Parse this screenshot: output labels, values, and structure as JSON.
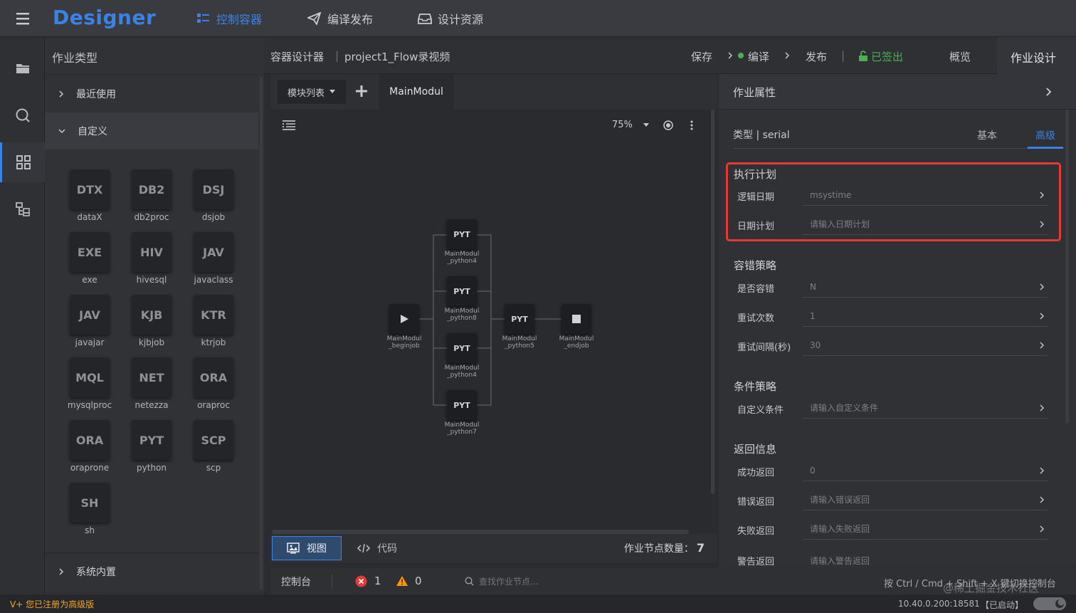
{
  "topbar": {
    "logo": "Designer",
    "nav": [
      {
        "label": "控制容器",
        "icon": "container-icon",
        "active": true
      },
      {
        "label": "编译发布",
        "icon": "send-icon",
        "active": false
      },
      {
        "label": "设计资源",
        "icon": "tray-icon",
        "active": false
      }
    ]
  },
  "left_panel": {
    "title": "作业类型",
    "groups": {
      "recent": "最近使用",
      "custom": "自定义",
      "builtin": "系统内置"
    },
    "tiles": [
      {
        "code": "DTX",
        "label": "dataX"
      },
      {
        "code": "DB2",
        "label": "db2proc"
      },
      {
        "code": "DSJ",
        "label": "dsjob"
      },
      {
        "code": "EXE",
        "label": "exe"
      },
      {
        "code": "HIV",
        "label": "hivesql"
      },
      {
        "code": "JAV",
        "label": "javaclass"
      },
      {
        "code": "JAV",
        "label": "javajar"
      },
      {
        "code": "KJB",
        "label": "kjbjob"
      },
      {
        "code": "KTR",
        "label": "ktrjob"
      },
      {
        "code": "MQL",
        "label": "mysqlproc"
      },
      {
        "code": "NET",
        "label": "netezza"
      },
      {
        "code": "ORA",
        "label": "oraproc"
      },
      {
        "code": "ORA",
        "label": "oraprone"
      },
      {
        "code": "PYT",
        "label": "python"
      },
      {
        "code": "SCP",
        "label": "scp"
      },
      {
        "code": "SH",
        "label": "sh"
      }
    ]
  },
  "header": {
    "breadcrumb_root": "容器设计器",
    "breadcrumb_sep": "|",
    "project": "project1_Flow录视频",
    "save": "保存",
    "compile": "编译",
    "publish": "发布",
    "sep": "|",
    "checked_out": "已签出",
    "overview": "概览",
    "job_design": "作业设计"
  },
  "canvas": {
    "module_list": "模块列表",
    "main_tab": "MainModul",
    "zoom": "75%",
    "nodes": [
      {
        "code": "PYT",
        "label1": "MainModul",
        "label2": "_python4"
      },
      {
        "code": "PYT",
        "label1": "MainModul",
        "label2": "_python8"
      },
      {
        "code": "PYT",
        "label1": "MainModul",
        "label2": "_python4"
      },
      {
        "code": "PYT",
        "label1": "MainModul",
        "label2": "_python7"
      },
      {
        "code": "PYT",
        "label1": "MainModul",
        "label2": "_python5"
      },
      {
        "code": "",
        "label1": "MainModul",
        "label2": "_beginjob"
      },
      {
        "code": "",
        "label1": "MainModul",
        "label2": "_endjob"
      }
    ],
    "view": "视图",
    "code": "代码",
    "node_count_label": "作业节点数量：",
    "node_count": "7"
  },
  "right_panel": {
    "title": "作业属性",
    "type_label": "类型 | serial",
    "tab_basic": "基本",
    "tab_advanced": "高级",
    "sections": {
      "schedule": {
        "title": "执行计划",
        "rows": [
          {
            "label": "逻辑日期",
            "value": "msystime"
          },
          {
            "label": "日期计划",
            "value": "请输入日期计划"
          }
        ]
      },
      "fault": {
        "title": "容错策略",
        "rows": [
          {
            "label": "是否容错",
            "value": "N"
          },
          {
            "label": "重试次数",
            "value": "1"
          },
          {
            "label": "重试间隔(秒)",
            "value": "30"
          }
        ]
      },
      "condition": {
        "title": "条件策略",
        "rows": [
          {
            "label": "自定义条件",
            "value": "请输入自定义条件"
          }
        ]
      },
      "returns": {
        "title": "返回信息",
        "rows": [
          {
            "label": "成功返回",
            "value": "0"
          },
          {
            "label": "错误返回",
            "value": "请输入错误返回"
          },
          {
            "label": "失败返回",
            "value": "请输入失败返回"
          },
          {
            "label": "警告返回",
            "value": "请输入警告返回"
          }
        ]
      }
    }
  },
  "console": {
    "title": "控制台",
    "errors": "1",
    "warnings": "0",
    "search_placeholder": "查找作业节点...",
    "hint": "按 Ctrl / Cmd + Shift + X 键切换控制台",
    "watermark": "@稀土掘金技术社区"
  },
  "status": {
    "register": "V+ 您已注册为高级版",
    "server": "10.40.0.200:18581",
    "state": "【已启动】"
  },
  "colors": {
    "accent": "#3b82e6",
    "success": "#4caf50",
    "error": "#e53935",
    "warning": "#ff9800"
  }
}
